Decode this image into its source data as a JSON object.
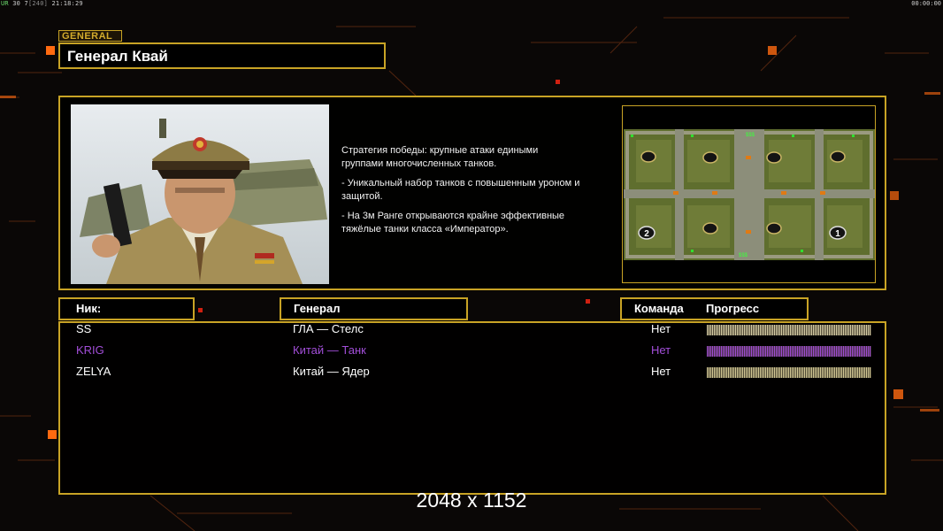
{
  "hud": {
    "ur": "UR",
    "fps": "30",
    "frame": "7",
    "frame_total": "[240]",
    "clock": "21:18:29",
    "timer": "00:00:00"
  },
  "general_tag": "GENERAL",
  "general_name": "Генерал Квай",
  "description": [
    "Стратегия победы: крупные атаки едиными\n группами многочисленных танков.",
    "- Уникальный набор танков с повышенным уроном и\n  защитой.",
    "- На 3м Ранге открываются крайне эффективные\n  тяжёлые танки класса «Император»."
  ],
  "minimap": {
    "start_positions": [
      "2",
      "1"
    ],
    "supply_labels": [
      "$$$",
      "$$$"
    ]
  },
  "columns": {
    "nick": "Ник:",
    "general": "Генерал",
    "team": "Команда",
    "progress": "Прогресс"
  },
  "players": [
    {
      "nick": "SS",
      "general": "ГЛА — Стелс",
      "team": "Нет",
      "color": "#ffffff",
      "progress_color": "#d9d0a8",
      "progress": 1.0
    },
    {
      "nick": "KRIG",
      "general": "Китай — Танк",
      "team": "Нет",
      "color": "#a24ed8",
      "progress_color": "#a24ed8",
      "progress": 1.0
    },
    {
      "nick": "ZELYA",
      "general": "Китай — Ядер",
      "team": "Нет",
      "color": "#ffffff",
      "progress_color": "#d6cc98",
      "progress": 1.0
    }
  ],
  "resolution_label": "2048 x 1152",
  "colors": {
    "frame_gold": "#c8a325",
    "background": "#0a0706",
    "accent_orange": "#ff6a10"
  }
}
